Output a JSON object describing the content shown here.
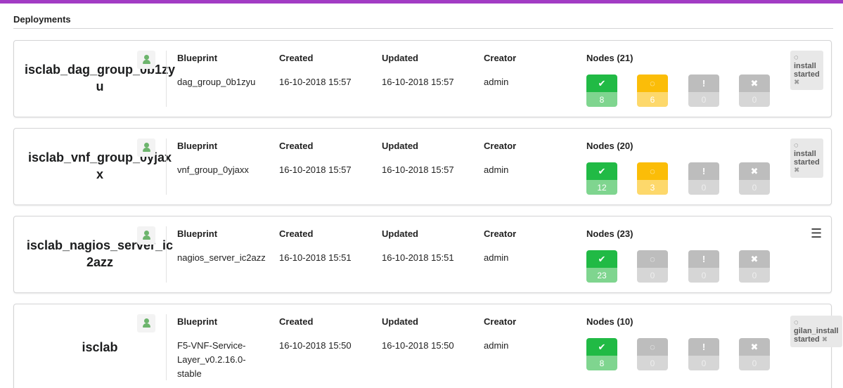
{
  "widget": {
    "title": "Deployments"
  },
  "headers": {
    "blueprint": "Blueprint",
    "created": "Created",
    "updated": "Updated",
    "creator": "Creator"
  },
  "icons": {
    "success": "check-icon",
    "in_progress": "spinner-icon",
    "warning": "exclamation-icon",
    "failed": "x-icon",
    "user": "user-icon",
    "menu": "hamburger-menu-icon"
  },
  "colors": {
    "accent": "#a23cc4",
    "success": "#21ba45",
    "in_progress": "#fbbd08",
    "inactive": "#bdbdbd"
  },
  "deployments": [
    {
      "name": "isclab_dag_group_0b1zyu",
      "name_line1": "isclab_dag_group_0b1zy",
      "name_line2": "u",
      "blueprint": "dag_group_0b1zyu",
      "created": "16-10-2018 15:57",
      "updated": "16-10-2018 15:57",
      "creator": "admin",
      "nodes_label": "Nodes (21)",
      "nodes": {
        "success": "8",
        "in_progress": "6",
        "warning": "0",
        "failed": "0"
      },
      "status": {
        "line1": "install",
        "line2": "started",
        "close": "✖"
      }
    },
    {
      "name": "isclab_vnf_group_0yjaxx",
      "name_line1": "isclab_vnf_group_0yjax",
      "name_line2": "x",
      "blueprint": "vnf_group_0yjaxx",
      "created": "16-10-2018 15:57",
      "updated": "16-10-2018 15:57",
      "creator": "admin",
      "nodes_label": "Nodes (20)",
      "nodes": {
        "success": "12",
        "in_progress": "3",
        "warning": "0",
        "failed": "0"
      },
      "status": {
        "line1": "install",
        "line2": "started",
        "close": "✖"
      }
    },
    {
      "name": "isclab_nagios_server_ic2azz",
      "name_line1": "isclab_nagios_server_ic",
      "name_line2": "2azz",
      "blueprint": "nagios_server_ic2azz",
      "created": "16-10-2018 15:51",
      "updated": "16-10-2018 15:51",
      "creator": "admin",
      "nodes_label": "Nodes (23)",
      "nodes": {
        "success": "23",
        "in_progress": "0",
        "warning": "0",
        "failed": "0"
      }
    },
    {
      "name": "isclab",
      "blueprint_line1": "F5-VNF-Service-",
      "blueprint_line2": "Layer_v0.2.16.0-",
      "blueprint_line3": "stable",
      "created": "16-10-2018 15:50",
      "updated": "16-10-2018 15:50",
      "creator": "admin",
      "nodes_label": "Nodes (10)",
      "nodes": {
        "success": "8",
        "in_progress": "0",
        "warning": "0",
        "failed": "0"
      },
      "status": {
        "line1": "gilan_install",
        "line2": "started",
        "close": "✖"
      }
    }
  ]
}
